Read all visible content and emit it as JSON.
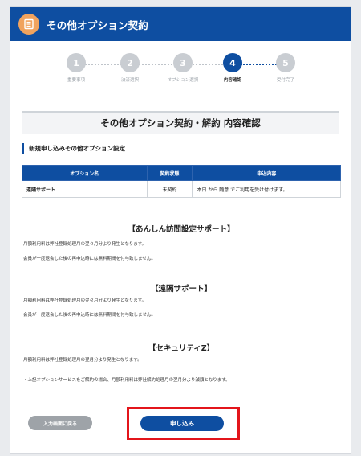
{
  "header": {
    "title": "その他オプション契約",
    "icon": "document-list-icon"
  },
  "stepper": {
    "steps": [
      {
        "number": "1",
        "label": "重要事項"
      },
      {
        "number": "2",
        "label": "決済選択"
      },
      {
        "number": "3",
        "label": "オプション選択"
      },
      {
        "number": "4",
        "label": "内容確認"
      },
      {
        "number": "5",
        "label": "受付完了"
      }
    ],
    "current_index": 3
  },
  "page_title": "その他オプション契約・解約 内容確認",
  "section_title": "新規申し込みその他オプション設定",
  "table": {
    "headers": [
      "オプション名",
      "契約状態",
      "申込内容"
    ],
    "rows": [
      [
        "遠隔サポート",
        "未契約",
        "本日 から 随意 でご利用を受け付けます。"
      ]
    ]
  },
  "info": {
    "block1": {
      "title": "【あんしん訪問設定サポート】",
      "lines": [
        "月額利用料は弊社登録処理月の翌々月分より発生となります。",
        "会員が一度退会した後の再申込時には無料期間を付与致しません。"
      ]
    },
    "block2": {
      "title": "【遠隔サポート】",
      "lines": [
        "月額利用料は弊社登録処理月の翌々月分より発生となります。",
        "会員が一度退会した後の再申込時には無料期間を付与致しません。"
      ]
    },
    "block3": {
      "title": "【セキュリティZ】",
      "lines": [
        "月額利用料は弊社登録処理月の翌月分より発生となります。"
      ]
    },
    "note": "・上記オプションサービスをご解約の場合、月額利用料は弊社解約処理月の翌月分より減額となります。"
  },
  "buttons": {
    "back": "入力画面に戻る",
    "apply": "申し込み"
  },
  "colors": {
    "primary": "#0e4ea1",
    "header_icon": "#f0a35e",
    "step_inactive": "#c9cdd2",
    "back_button": "#9ea3a8",
    "highlight": "#e3151b"
  }
}
